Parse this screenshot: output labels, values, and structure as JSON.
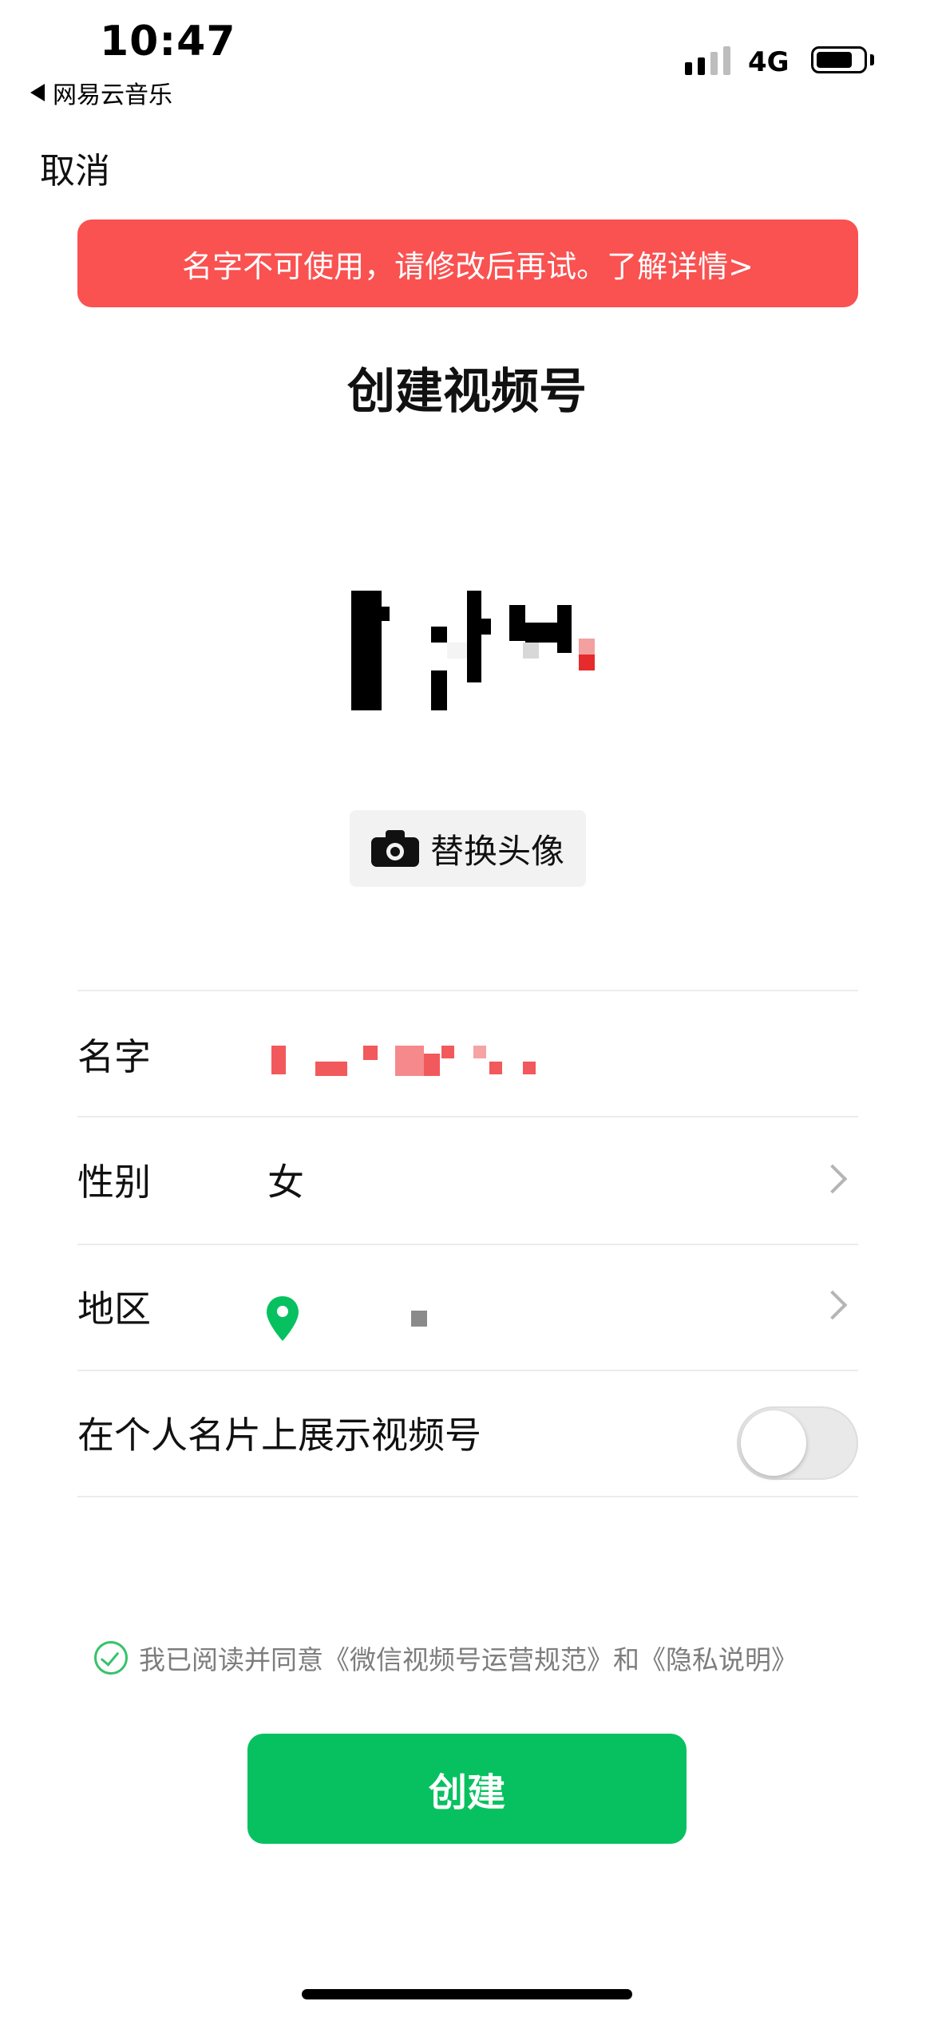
{
  "status_bar": {
    "time": "10:47",
    "back_app": "网易云音乐",
    "network": "4G",
    "battery_level": 0.78
  },
  "nav": {
    "cancel_label": "取消"
  },
  "alert": {
    "message": "名字不可使用，请修改后再试。了解详情>",
    "color": "#fa5151"
  },
  "page": {
    "title": "创建视频号"
  },
  "avatar": {
    "change_label": "替换头像"
  },
  "form": {
    "name_label": "名字",
    "gender_label": "性别",
    "gender_value": "女",
    "region_label": "地区",
    "show_on_card_label": "在个人名片上展示视频号",
    "show_on_card_enabled": false
  },
  "agreement": {
    "checked": true,
    "prefix": "我已阅读并同意",
    "rules_link": "《微信视频号运营规范》",
    "conjunction": "和",
    "privacy_link": "《隐私说明》"
  },
  "actions": {
    "create_label": "创建",
    "accent_color": "#07c160"
  }
}
